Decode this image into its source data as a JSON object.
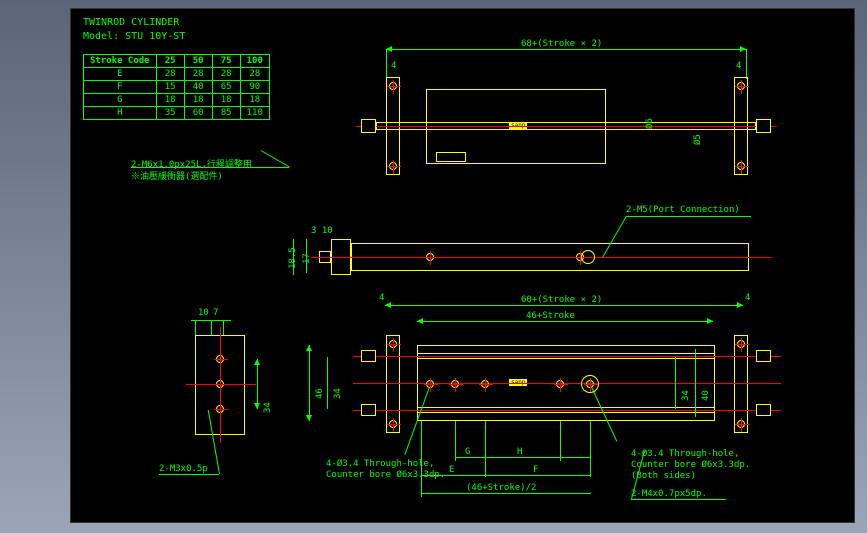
{
  "title": {
    "line1": "TWINROD CYLINDER",
    "line2": "Model: STU 10Y-ST"
  },
  "stroke_table": {
    "header": [
      "Stroke Code",
      "25",
      "50",
      "75",
      "100"
    ],
    "rows": [
      {
        "code": "E",
        "v": [
          "28",
          "28",
          "28",
          "28"
        ]
      },
      {
        "code": "F",
        "v": [
          "15",
          "40",
          "65",
          "90"
        ]
      },
      {
        "code": "G",
        "v": [
          "18",
          "18",
          "18",
          "18"
        ]
      },
      {
        "code": "H",
        "v": [
          "35",
          "60",
          "85",
          "110"
        ]
      }
    ]
  },
  "dimensions": {
    "top_overall": "68+(Stroke × 2)",
    "bottom_overall": "60+(Stroke × 2)",
    "bottom_inner": "46+Stroke",
    "bottom_formula": "(46+Stroke)/2",
    "side_185": "18.5",
    "side_17": "17",
    "side_310": "3 10",
    "side_46": "46",
    "side_34": "34",
    "side_40": "40",
    "side_10": "10",
    "side_7": "7",
    "side_4": "4",
    "dia_6": "Ø6",
    "dia_5": "Ø5",
    "letters": {
      "e": "E",
      "f": "F",
      "g": "G",
      "h": "H"
    }
  },
  "notes": {
    "stroke_adjust": "2-M6x1.0px25L,行程調整用",
    "buffer": "※油壓緩衝器(選配件)",
    "port": "2-M5(Port Connection)",
    "m3": "2-M3x0.5p",
    "through1": "4-Ø3.4 Through-hole,",
    "through1b": "Counter bore Ø6x3.3dp.",
    "through2": "4-Ø3.4 Through-hole,",
    "through2b": "Counter bore Ø6x3.3dp.",
    "through2c": "(Both sides)",
    "m4": "2-M4x0.7px5dp."
  },
  "label": {
    "sanp": "sanp"
  }
}
